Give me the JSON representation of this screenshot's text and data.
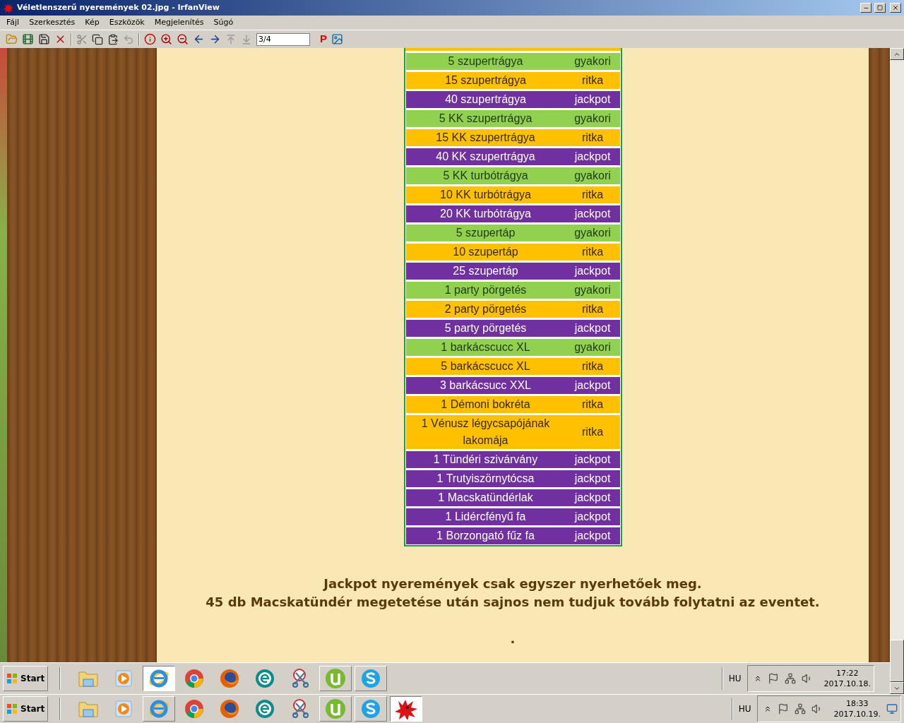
{
  "window": {
    "title": "Véletlenszerű nyeremények 02.jpg - IrfanView"
  },
  "menu": [
    "Fájl",
    "Szerkesztés",
    "Kép",
    "Eszközök",
    "Megjelenítés",
    "Súgó"
  ],
  "toolbar": {
    "page_field": "3/4",
    "p_label": "P"
  },
  "prize_table": {
    "rows": [
      {
        "item": "5 szupertrágya",
        "rarity": "gyakori",
        "kind": "common"
      },
      {
        "item": "15 szupertrágya",
        "rarity": "ritka",
        "kind": "rare"
      },
      {
        "item": "40 szupertrágya",
        "rarity": "jackpot",
        "kind": "jackpot"
      },
      {
        "item": "5 KK szupertrágya",
        "rarity": "gyakori",
        "kind": "common"
      },
      {
        "item": "15 KK szupertrágya",
        "rarity": "ritka",
        "kind": "rare"
      },
      {
        "item": "40 KK szupertrágya",
        "rarity": "jackpot",
        "kind": "jackpot"
      },
      {
        "item": "5 KK turbótrágya",
        "rarity": "gyakori",
        "kind": "common"
      },
      {
        "item": "10 KK turbótrágya",
        "rarity": "ritka",
        "kind": "rare"
      },
      {
        "item": "20 KK turbótrágya",
        "rarity": "jackpot",
        "kind": "jackpot"
      },
      {
        "item": "5 szupertáp",
        "rarity": "gyakori",
        "kind": "common"
      },
      {
        "item": "10 szupertáp",
        "rarity": "ritka",
        "kind": "rare"
      },
      {
        "item": "25 szupertáp",
        "rarity": "jackpot",
        "kind": "jackpot"
      },
      {
        "item": "1 party pörgetés",
        "rarity": "gyakori",
        "kind": "common"
      },
      {
        "item": "2 party pörgetés",
        "rarity": "ritka",
        "kind": "rare"
      },
      {
        "item": "5 party pörgetés",
        "rarity": "jackpot",
        "kind": "jackpot"
      },
      {
        "item": "1 barkácscucc XL",
        "rarity": "gyakori",
        "kind": "common"
      },
      {
        "item": "5 barkácscucc XL",
        "rarity": "ritka",
        "kind": "rare"
      },
      {
        "item": "3 barkácsucc XXL",
        "rarity": "jackpot",
        "kind": "jackpot"
      },
      {
        "item": "1 Démoni bokréta",
        "rarity": "ritka",
        "kind": "rare"
      },
      {
        "item": "1 Vénusz légycsapójának lakomája",
        "rarity": "ritka",
        "kind": "rare"
      },
      {
        "item": "1 Tündéri szivárvány",
        "rarity": "jackpot",
        "kind": "jackpot"
      },
      {
        "item": "1 Trutyiszörnytócsa",
        "rarity": "jackpot",
        "kind": "jackpot"
      },
      {
        "item": "1 Macskatündérlak",
        "rarity": "jackpot",
        "kind": "jackpot"
      },
      {
        "item": "1 Lidércfényű fa",
        "rarity": "jackpot",
        "kind": "jackpot"
      },
      {
        "item": "1 Borzongató fűz fa",
        "rarity": "jackpot",
        "kind": "jackpot"
      }
    ]
  },
  "notes": [
    "Jackpot nyeremények csak egyszer nyerhetőek meg.",
    "45 db Macskatündér megetetése után sajnos nem tudjuk tovább folytatni az eventet.",
    "."
  ],
  "inner_taskbar": {
    "start": "Start",
    "apps": [
      {
        "kind": "explorer",
        "running": false,
        "selected": false
      },
      {
        "kind": "media",
        "running": false,
        "selected": false
      },
      {
        "kind": "ie",
        "running": true,
        "selected": true
      },
      {
        "kind": "chrome",
        "running": false,
        "selected": false
      },
      {
        "kind": "firefox",
        "running": false,
        "selected": false
      },
      {
        "kind": "eset",
        "running": false,
        "selected": false
      },
      {
        "kind": "snip",
        "running": false,
        "selected": false
      },
      {
        "kind": "torrent",
        "running": true,
        "selected": false
      },
      {
        "kind": "skype",
        "running": true,
        "selected": false
      }
    ],
    "language": "HU",
    "time": "17:22",
    "date": "2017.10.18."
  },
  "taskbar": {
    "start": "Start",
    "apps": [
      {
        "kind": "explorer",
        "running": false,
        "selected": false
      },
      {
        "kind": "media",
        "running": false,
        "selected": false
      },
      {
        "kind": "ie",
        "running": true,
        "selected": false
      },
      {
        "kind": "chrome",
        "running": false,
        "selected": false
      },
      {
        "kind": "firefox",
        "running": false,
        "selected": false
      },
      {
        "kind": "eset",
        "running": false,
        "selected": false
      },
      {
        "kind": "snip",
        "running": false,
        "selected": false
      },
      {
        "kind": "torrent",
        "running": true,
        "selected": false
      },
      {
        "kind": "skype",
        "running": true,
        "selected": false
      },
      {
        "kind": "irfan",
        "running": true,
        "selected": true
      }
    ],
    "language": "HU",
    "time": "18:33",
    "date": "2017.10.19."
  }
}
